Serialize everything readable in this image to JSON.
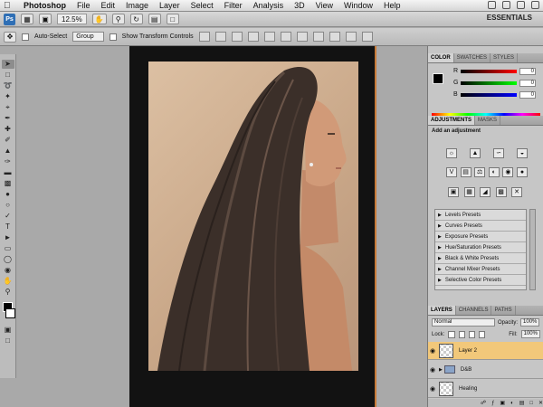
{
  "menubar": {
    "items": [
      "Photoshop",
      "File",
      "Edit",
      "Image",
      "Layer",
      "Select",
      "Filter",
      "Analysis",
      "3D",
      "View",
      "Window",
      "Help"
    ]
  },
  "appbar": {
    "logo": "Ps",
    "zoom": "12.5%",
    "workspace": "ESSENTIALS"
  },
  "options": {
    "auto_select": "Auto-Select",
    "group_value": "Group",
    "show_transform": "Show Transform Controls"
  },
  "colors": {
    "accent_layer": "#f2c87a",
    "canvas_frame": "#121212",
    "panel_bg": "#c6c6c6"
  },
  "color_panel": {
    "tabs": [
      "COLOR",
      "SWATCHES",
      "STYLES"
    ],
    "active_tab": "COLOR",
    "r_label": "R",
    "r_value": "0",
    "g_label": "G",
    "g_value": "0",
    "b_label": "B",
    "b_value": "0"
  },
  "adjustments": {
    "tabs": [
      "ADJUSTMENTS",
      "MASKS"
    ],
    "active_tab": "ADJUSTMENTS",
    "title": "Add an adjustment",
    "presets": [
      "Levels Presets",
      "Curves Presets",
      "Exposure Presets",
      "Hue/Saturation Presets",
      "Black & White Presets",
      "Channel Mixer Presets",
      "Selective Color Presets"
    ]
  },
  "layers": {
    "tabs": [
      "LAYERS",
      "CHANNELS",
      "PATHS"
    ],
    "active_tab": "LAYERS",
    "blend_mode": "Normal",
    "opacity_label": "Opacity:",
    "opacity_value": "100%",
    "lock_label": "Lock:",
    "fill_label": "Fill:",
    "fill_value": "100%",
    "items": [
      {
        "name": "Layer 2",
        "selected": true
      },
      {
        "name": "D&B",
        "selected": false
      },
      {
        "name": "Healing",
        "selected": false
      }
    ]
  }
}
